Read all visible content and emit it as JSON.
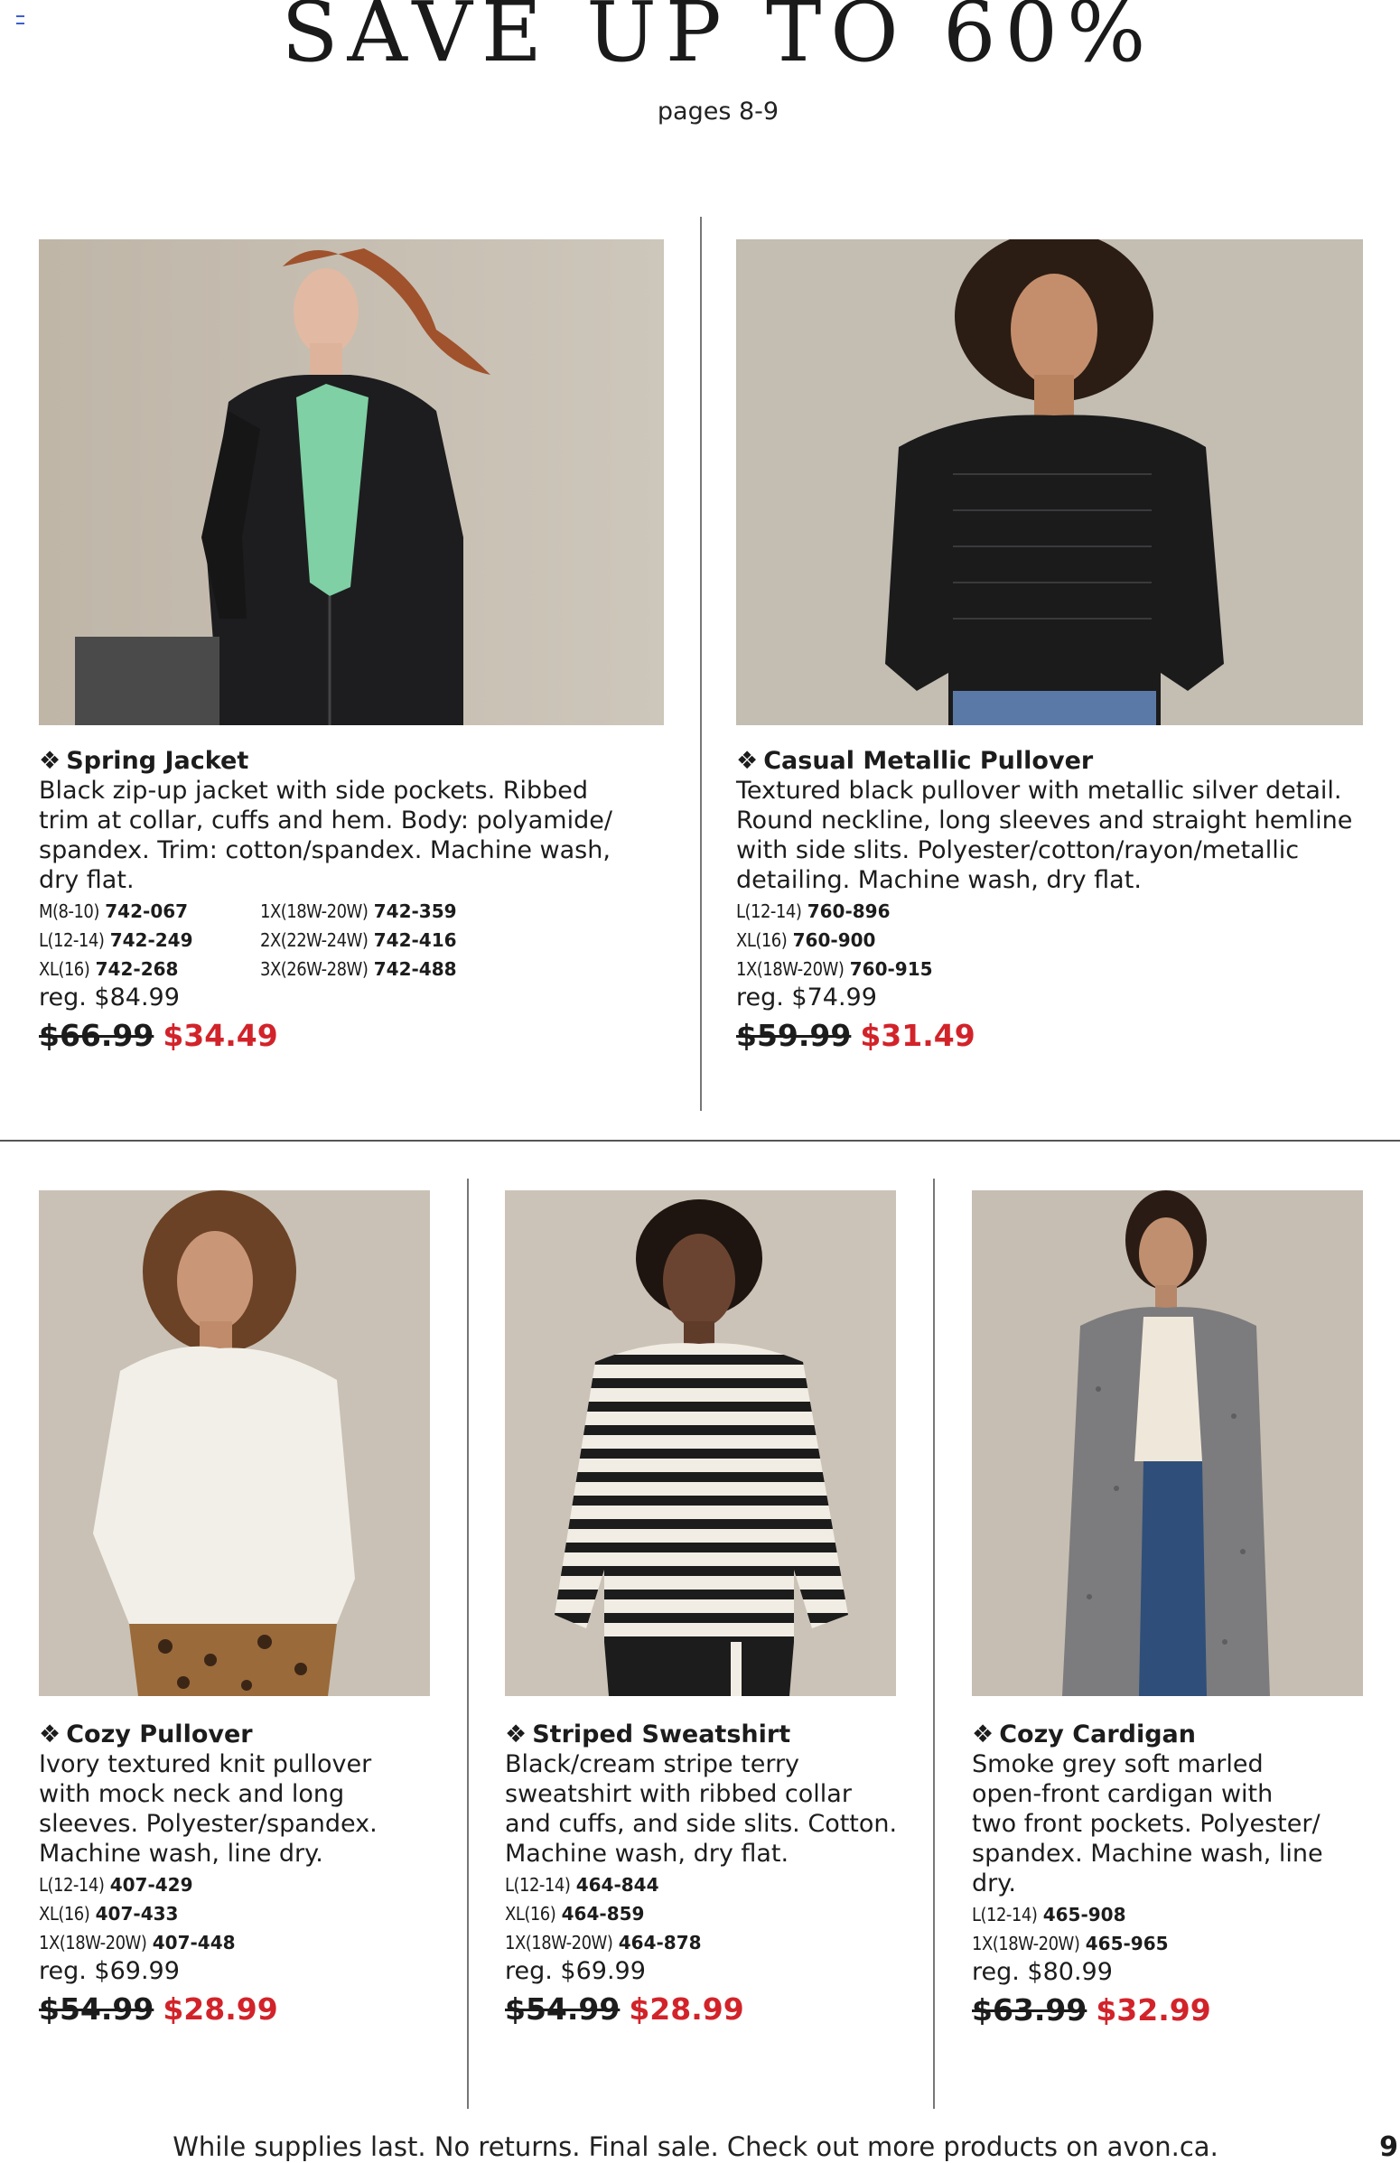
{
  "header": {
    "headline": "SAVE UP TO 60%",
    "pages": "pages 8-9"
  },
  "colors": {
    "sale_price": "#d2232a",
    "text": "#1c1c1c",
    "photo_bg": "#c7bfb3"
  },
  "products": [
    {
      "name": "Spring Jacket",
      "bullet": "❖",
      "description": [
        "Black zip-up jacket with side pockets. Ribbed",
        "trim at collar, cuffs and hem. Body: polyamide/",
        "spandex. Trim: cotton/spandex. Machine wash,",
        "dry flat."
      ],
      "sizes_left": [
        {
          "size": "M(8-10)",
          "code": "742-067"
        },
        {
          "size": "L(12-14)",
          "code": "742-249"
        },
        {
          "size": "XL(16)",
          "code": "742-268"
        }
      ],
      "sizes_right": [
        {
          "size": "1X(18W-20W)",
          "code": "742-359"
        },
        {
          "size": "2X(22W-24W)",
          "code": "742-416"
        },
        {
          "size": "3X(26W-28W)",
          "code": "742-488"
        }
      ],
      "regular": "reg. $84.99",
      "was_price": "$66.99",
      "sale_price": "$34.49"
    },
    {
      "name": "Casual Metallic Pullover",
      "bullet": "❖",
      "description": [
        "Textured black pullover with metallic silver detail.",
        "Round neckline, long sleeves and straight hemline",
        "with side slits. Polyester/cotton/rayon/metallic",
        "detailing. Machine wash, dry flat."
      ],
      "sizes_left": [
        {
          "size": "L(12-14)",
          "code": "760-896"
        },
        {
          "size": "XL(16)",
          "code": "760-900"
        },
        {
          "size": "1X(18W-20W)",
          "code": "760-915"
        }
      ],
      "regular": "reg. $74.99",
      "was_price": "$59.99",
      "sale_price": "$31.49"
    },
    {
      "name": "Cozy Pullover",
      "bullet": "❖",
      "description": [
        "Ivory textured knit pullover",
        "with mock neck and long",
        "sleeves. Polyester/spandex.",
        "Machine wash, line dry."
      ],
      "sizes_left": [
        {
          "size": "L(12-14)",
          "code": "407-429"
        },
        {
          "size": "XL(16)",
          "code": "407-433"
        },
        {
          "size": "1X(18W-20W)",
          "code": "407-448"
        }
      ],
      "regular": "reg. $69.99",
      "was_price": "$54.99",
      "sale_price": "$28.99"
    },
    {
      "name": "Striped Sweatshirt",
      "bullet": "❖",
      "description": [
        "Black/cream stripe terry",
        "sweatshirt with ribbed collar",
        "and cuffs, and side slits. Cotton.",
        "Machine wash, dry flat."
      ],
      "sizes_left": [
        {
          "size": "L(12-14)",
          "code": "464-844"
        },
        {
          "size": "XL(16)",
          "code": "464-859"
        },
        {
          "size": "1X(18W-20W)",
          "code": "464-878"
        }
      ],
      "regular": "reg. $69.99",
      "was_price": "$54.99",
      "sale_price": "$28.99"
    },
    {
      "name": "Cozy Cardigan",
      "bullet": "❖",
      "description": [
        "Smoke grey soft marled",
        "open-front cardigan with",
        "two front pockets. Polyester/",
        "spandex. Machine wash, line",
        "dry."
      ],
      "sizes_left": [
        {
          "size": "L(12-14)",
          "code": "465-908"
        },
        {
          "size": "1X(18W-20W)",
          "code": "465-965"
        }
      ],
      "regular": "reg. $80.99",
      "was_price": "$63.99",
      "sale_price": "$32.99"
    }
  ],
  "footer": {
    "note": "While supplies last. No returns. Final sale. Check out more products on avon.ca.",
    "page_number": "9"
  }
}
